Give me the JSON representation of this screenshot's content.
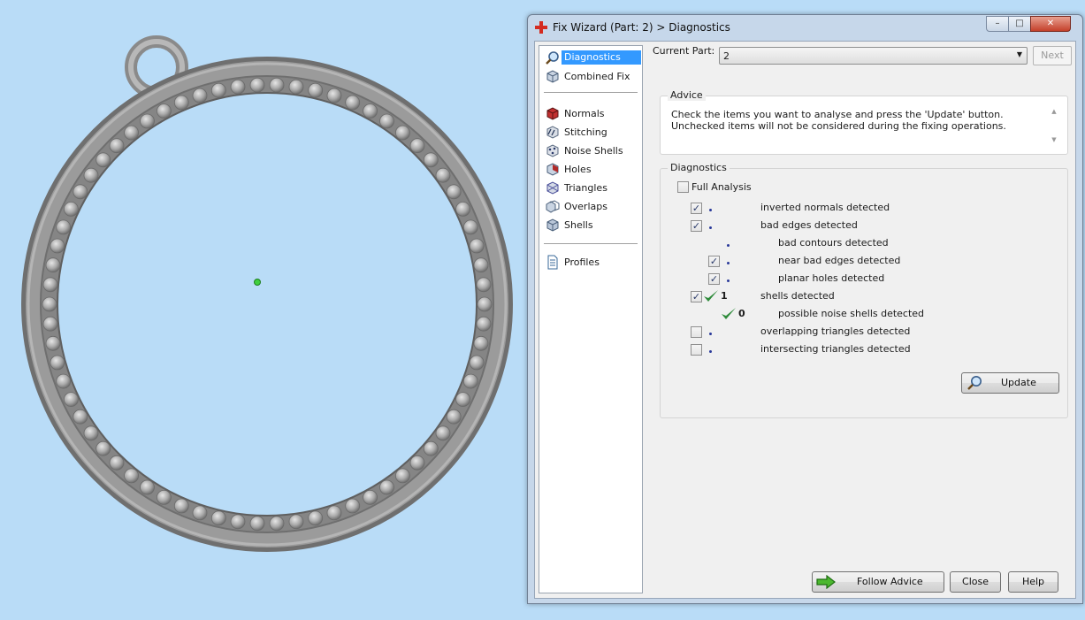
{
  "window": {
    "title": "Fix Wizard (Part: 2) > Diagnostics",
    "controls": {
      "minimize": "–",
      "maximize": "□",
      "close": "✕"
    }
  },
  "nav": {
    "top": [
      {
        "label": "Diagnostics",
        "icon": "magnifier-icon",
        "selected": true
      },
      {
        "label": "Combined Fix",
        "icon": "cube-icon"
      }
    ],
    "fixes": [
      {
        "label": "Normals",
        "icon": "normals-icon"
      },
      {
        "label": "Stitching",
        "icon": "stitching-icon"
      },
      {
        "label": "Noise Shells",
        "icon": "noise-shells-icon"
      },
      {
        "label": "Holes",
        "icon": "holes-icon"
      },
      {
        "label": "Triangles",
        "icon": "triangles-icon"
      },
      {
        "label": "Overlaps",
        "icon": "overlaps-icon"
      },
      {
        "label": "Shells",
        "icon": "shells-icon"
      }
    ],
    "bottom": [
      {
        "label": "Profiles",
        "icon": "document-icon"
      }
    ]
  },
  "header": {
    "current_part_label": "Current Part:",
    "current_part_value": "2",
    "next_label": "Next"
  },
  "advice": {
    "title": "Advice",
    "text": "Check the items you want to analyse and press the 'Update' button. Unchecked items will not be considered during the fixing operations."
  },
  "diagnostics": {
    "title": "Diagnostics",
    "full_analysis_label": "Full Analysis",
    "full_analysis_checked": false,
    "rows": [
      {
        "label": "inverted normals detected",
        "checked": true,
        "status": "dot",
        "count": ""
      },
      {
        "label": "bad edges detected",
        "checked": true,
        "status": "dot",
        "count": ""
      },
      {
        "label": "bad contours detected",
        "checked": null,
        "status": "dot",
        "count": ""
      },
      {
        "label": "near bad edges detected",
        "checked": true,
        "status": "dot",
        "count": ""
      },
      {
        "label": "planar holes detected",
        "checked": true,
        "status": "dot",
        "count": ""
      },
      {
        "label": "shells detected",
        "checked": true,
        "status": "ok",
        "count": "1"
      },
      {
        "label": "possible noise shells detected",
        "checked": null,
        "status": "ok",
        "count": "0"
      },
      {
        "label": "overlapping triangles detected",
        "checked": false,
        "status": "dot",
        "count": ""
      },
      {
        "label": "intersecting triangles detected",
        "checked": false,
        "status": "dot",
        "count": ""
      }
    ],
    "update_label": "Update"
  },
  "footer": {
    "follow_advice_label": "Follow Advice",
    "close_label": "Close",
    "help_label": "Help"
  },
  "colors": {
    "viewport_background": "#b9dcf7",
    "selection": "#3399ff",
    "ok_check": "#2e8b3a",
    "status_dot": "#2a3a9a"
  }
}
